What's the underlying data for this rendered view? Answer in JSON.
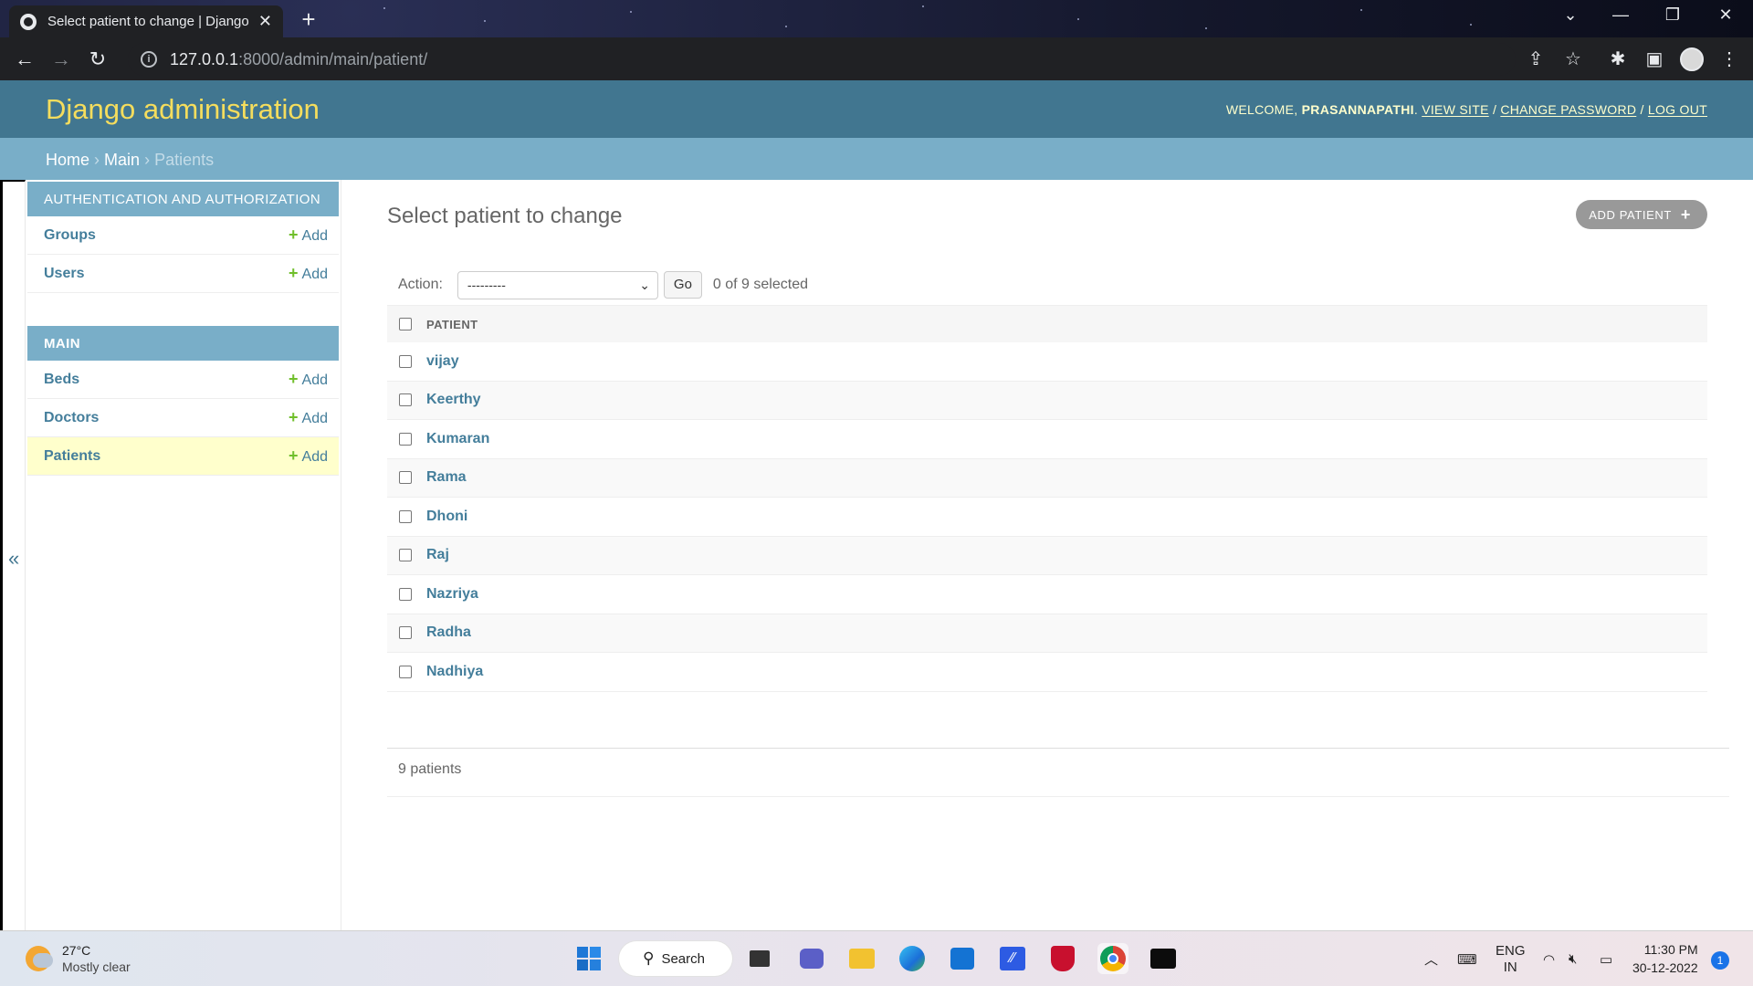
{
  "browser": {
    "tab_title": "Select patient to change | Django",
    "url_host": "127.0.0.1",
    "url_path": ":8000/admin/main/patient/"
  },
  "header": {
    "brand": "Django administration",
    "welcome": "WELCOME,",
    "username": "PRASANNAPATHI",
    "view_site": "VIEW SITE",
    "change_password": "CHANGE PASSWORD",
    "log_out": "LOG OUT",
    "separator": "/"
  },
  "breadcrumbs": {
    "home": "Home",
    "app": "Main",
    "current": "Patients",
    "sep": "›"
  },
  "sidebar": {
    "modules": [
      {
        "caption": "AUTHENTICATION AND AUTHORIZATION",
        "models": [
          {
            "name": "Groups",
            "add": "Add"
          },
          {
            "name": "Users",
            "add": "Add"
          }
        ]
      },
      {
        "caption": "MAIN",
        "models": [
          {
            "name": "Beds",
            "add": "Add"
          },
          {
            "name": "Doctors",
            "add": "Add"
          },
          {
            "name": "Patients",
            "add": "Add"
          }
        ]
      }
    ],
    "toggle": "«"
  },
  "content": {
    "title": "Select patient to change",
    "add_button": "ADD PATIENT",
    "action_label": "Action:",
    "action_value": "---------",
    "go_label": "Go",
    "selected_count": "0 of 9 selected",
    "column_header": "PATIENT",
    "patients": [
      "vijay",
      "Keerthy",
      "Kumaran",
      "Rama",
      "Dhoni",
      "Raj",
      "Nazriya",
      "Radha",
      "Nadhiya"
    ],
    "paginator": "9 patients"
  },
  "taskbar": {
    "temperature": "27°C",
    "weather": "Mostly clear",
    "search": "Search",
    "language": "ENG",
    "region": "IN",
    "time": "11:30 PM",
    "date": "30-12-2022",
    "notifications": "1"
  },
  "colors": {
    "header_bg": "#417690",
    "breadcrumb_bg": "#79aec8",
    "brand_text": "#f5dd5d",
    "link": "#447e9b",
    "add_plus": "#70bf2b"
  }
}
